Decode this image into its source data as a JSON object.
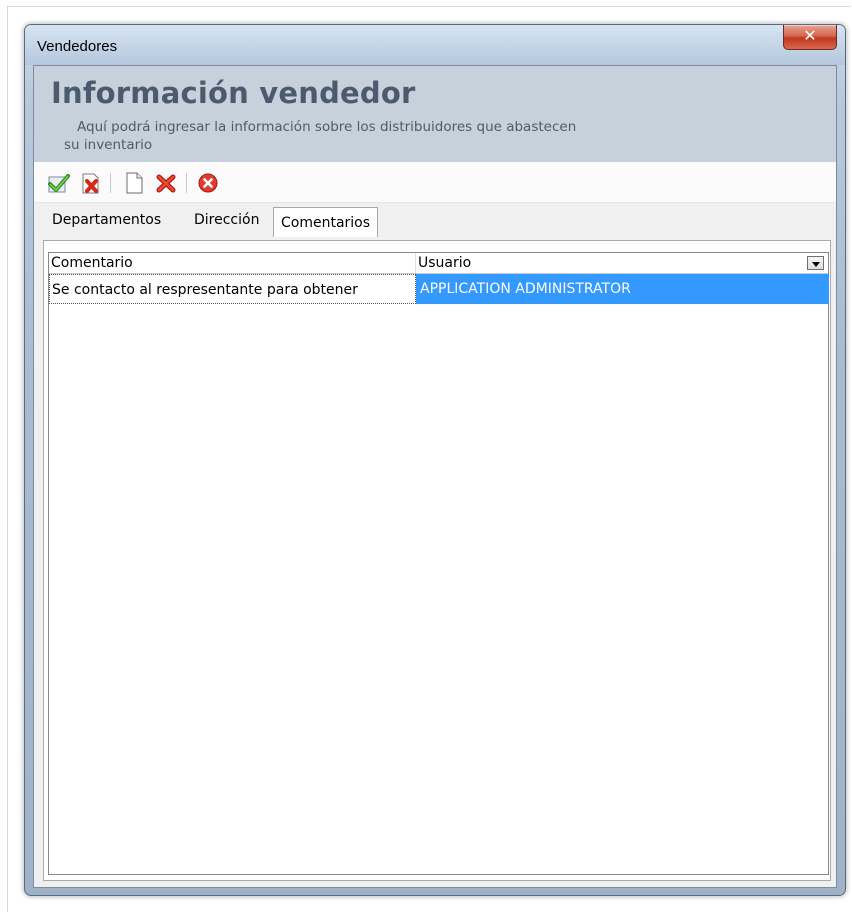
{
  "window": {
    "title": "Vendedores",
    "close_glyph": "✕"
  },
  "header": {
    "title": "Información vendedor",
    "description_line1": "Aquí podrá ingresar la información sobre los distribuidores que abastecen",
    "description_line2": "su inventario"
  },
  "toolbar": {
    "buttons": [
      {
        "icon": "save-check-icon"
      },
      {
        "icon": "delete-document-icon"
      },
      {
        "icon": "new-document-icon"
      },
      {
        "icon": "delete-x-icon"
      },
      {
        "icon": "cancel-circle-icon"
      }
    ]
  },
  "tabs": [
    {
      "label": "Departamentos",
      "active": false
    },
    {
      "label": "Dirección",
      "active": false
    },
    {
      "label": "Comentarios",
      "active": true
    }
  ],
  "grid": {
    "columns": [
      "Comentario",
      "Usuario"
    ],
    "rows": [
      {
        "comentario": "Se contacto al respresentante para obtener",
        "usuario": "APPLICATION ADMINISTRATOR"
      }
    ],
    "selection_color": "#3399ff"
  }
}
